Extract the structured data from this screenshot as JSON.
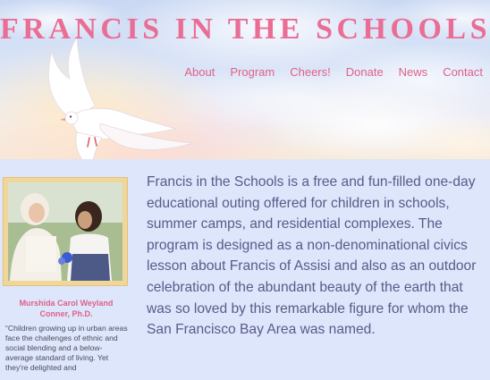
{
  "site": {
    "title": "FRANCIS IN THE SCHOOLS"
  },
  "nav": {
    "items": [
      {
        "label": "About"
      },
      {
        "label": "Program"
      },
      {
        "label": "Cheers!"
      },
      {
        "label": "Donate"
      },
      {
        "label": "News"
      },
      {
        "label": "Contact"
      }
    ]
  },
  "sidebar": {
    "caption_name": "Murshida Carol Weyland Conner, Ph.D.",
    "quote": "“Children growing up in urban areas face the challenges of ethnic and social blending and a below-average standard of living. Yet they're delighted and"
  },
  "main": {
    "intro": "Francis in the Schools is a free and fun-filled one-day educational outing offered for children in schools, summer camps, and residential complexes. The program is designed as a non-denominational civics lesson about Francis of Assisi and also as an outdoor celebration of the abundant beauty of the earth that was so loved by this remarkable figure for whom the San Francisco Bay Area was named."
  },
  "colors": {
    "accent_pink": "#ea6d95",
    "body_text": "#5a5a88",
    "background": "#dde6fb",
    "frame_gold": "#f1d69a"
  },
  "icons": {
    "hero": "dove-icon"
  }
}
